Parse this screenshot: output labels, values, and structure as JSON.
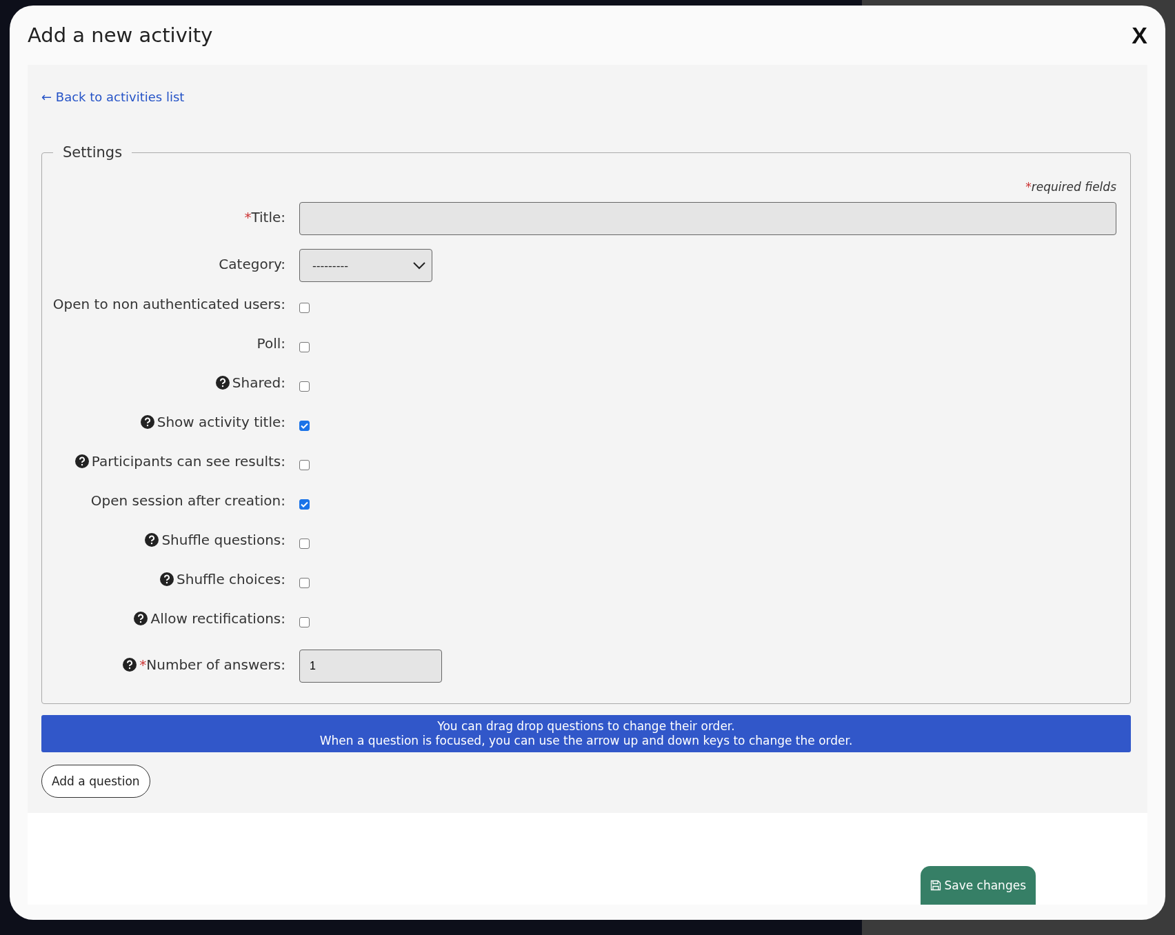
{
  "modal": {
    "title": "Add a new activity",
    "close": "X"
  },
  "back_link": "← Back to activities list",
  "settings": {
    "legend": "Settings",
    "required_note": {
      "mark": "*",
      "text": "required fields"
    },
    "fields": [
      {
        "kind": "text",
        "label": "Title:",
        "required": true,
        "help": false
      },
      {
        "kind": "select",
        "label": "Category:",
        "required": false,
        "help": false,
        "value": "---------"
      },
      {
        "kind": "checkbox",
        "label": "Open to non authenticated users:",
        "required": false,
        "help": false,
        "checked": false
      },
      {
        "kind": "checkbox",
        "label": "Poll:",
        "required": false,
        "help": false,
        "checked": false
      },
      {
        "kind": "checkbox",
        "label": "Shared:",
        "required": false,
        "help": true,
        "checked": false
      },
      {
        "kind": "checkbox",
        "label": "Show activity title:",
        "required": false,
        "help": true,
        "checked": true
      },
      {
        "kind": "checkbox",
        "label": "Participants can see results:",
        "required": false,
        "help": true,
        "checked": false
      },
      {
        "kind": "checkbox",
        "label": "Open session after creation:",
        "required": false,
        "help": false,
        "checked": true
      },
      {
        "kind": "checkbox",
        "label": "Shuffle questions:",
        "required": false,
        "help": true,
        "checked": false
      },
      {
        "kind": "checkbox",
        "label": "Shuffle choices:",
        "required": false,
        "help": true,
        "checked": false
      },
      {
        "kind": "checkbox",
        "label": "Allow rectifications:",
        "required": false,
        "help": true,
        "checked": false
      },
      {
        "kind": "number",
        "label": "Number of answers:",
        "required": true,
        "help": true,
        "value": "1"
      }
    ]
  },
  "info_banner": [
    "You can drag drop questions to change their order.",
    "When a question is focused, you can use the arrow up and down keys to change the order."
  ],
  "add_question_button": "Add a question",
  "save_button": "Save changes"
}
